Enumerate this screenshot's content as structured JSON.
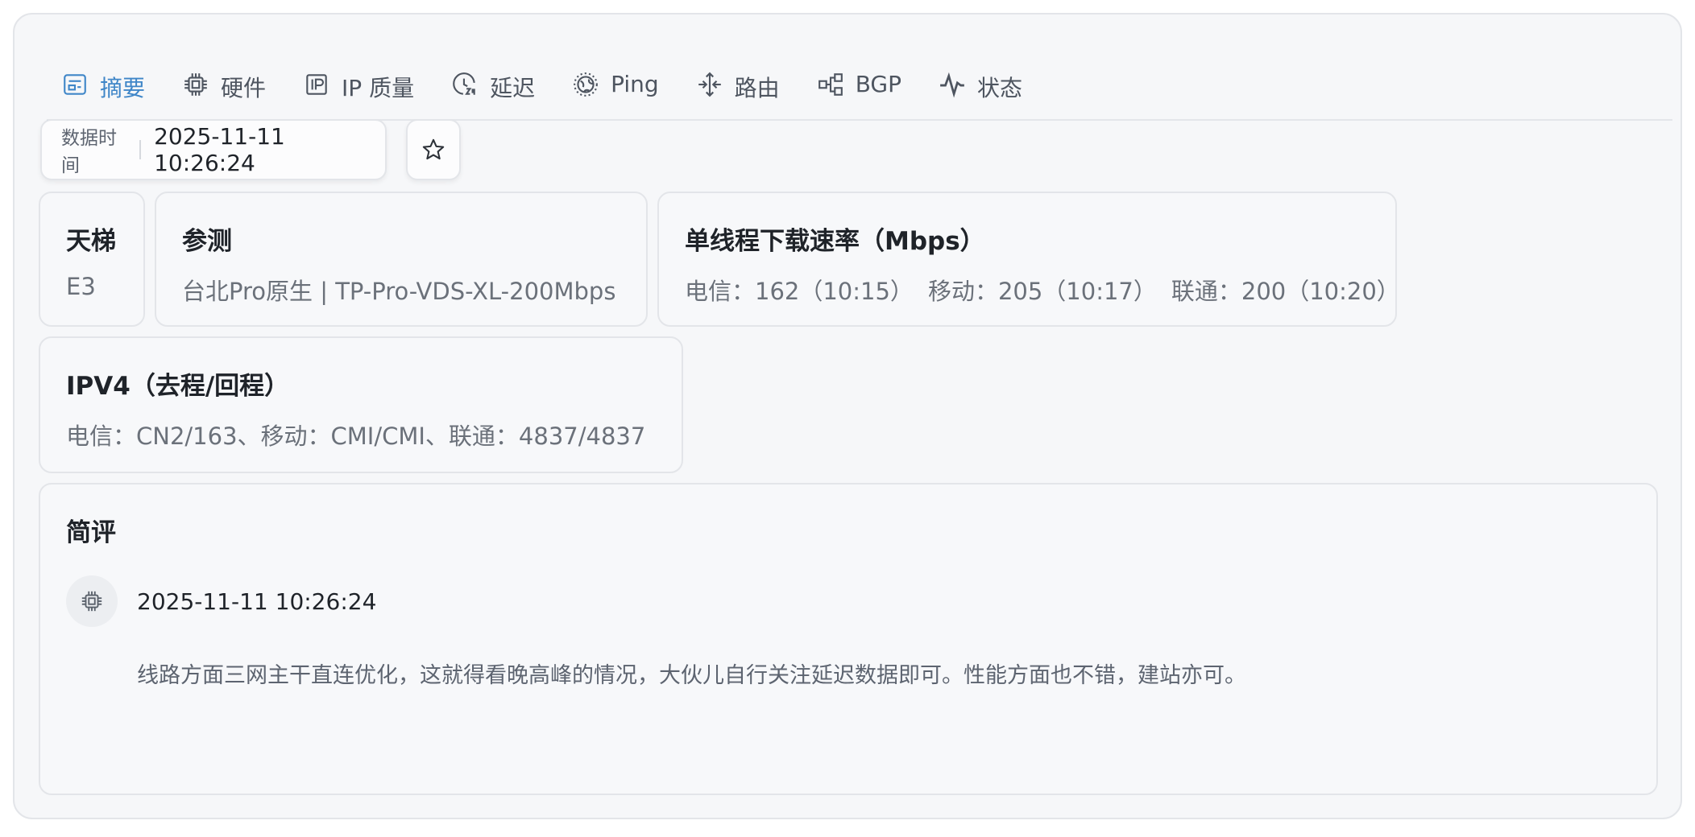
{
  "tabs": [
    {
      "label": "摘要",
      "icon": "summary-icon",
      "active": true
    },
    {
      "label": "硬件",
      "icon": "cpu-icon"
    },
    {
      "label": "IP 质量",
      "icon": "ip-icon"
    },
    {
      "label": "延迟",
      "icon": "latency-clock-icon"
    },
    {
      "label": "Ping",
      "icon": "globe-icon"
    },
    {
      "label": "路由",
      "icon": "route-icon"
    },
    {
      "label": "BGP",
      "icon": "network-icon"
    },
    {
      "label": "状态",
      "icon": "pulse-icon"
    }
  ],
  "data_time": {
    "label": "数据时间",
    "value": "2025-11-11 10:26:24"
  },
  "favorite": {
    "icon": "star-icon"
  },
  "cards": {
    "ladder": {
      "title": "天梯",
      "value": "E3"
    },
    "test": {
      "title": "参测",
      "value": "台北Pro原生 | TP-Pro-VDS-XL-200Mbps"
    },
    "speed": {
      "title": "单线程下载速率（Mbps）",
      "telecom": "电信：162（10:15）",
      "mobile": "移动：205（10:17）",
      "unicom": "联通：200（10:20）"
    },
    "ipv4": {
      "title": "IPV4（去程/回程）",
      "value": "电信：CN2/163、移动：CMI/CMI、联通：4837/4837"
    }
  },
  "review": {
    "title": "简评",
    "avatar_icon": "cpu-icon",
    "date": "2025-11-11 10:26:24",
    "text": "线路方面三网主干直连优化，这就得看晚高峰的情况，大伙儿自行关注延迟数据即可。性能方面也不错，建站亦可。"
  },
  "colors": {
    "accent": "#3f86c8",
    "text": "#1f2329",
    "muted": "#6b717a",
    "panel": "#f6f7f9"
  }
}
